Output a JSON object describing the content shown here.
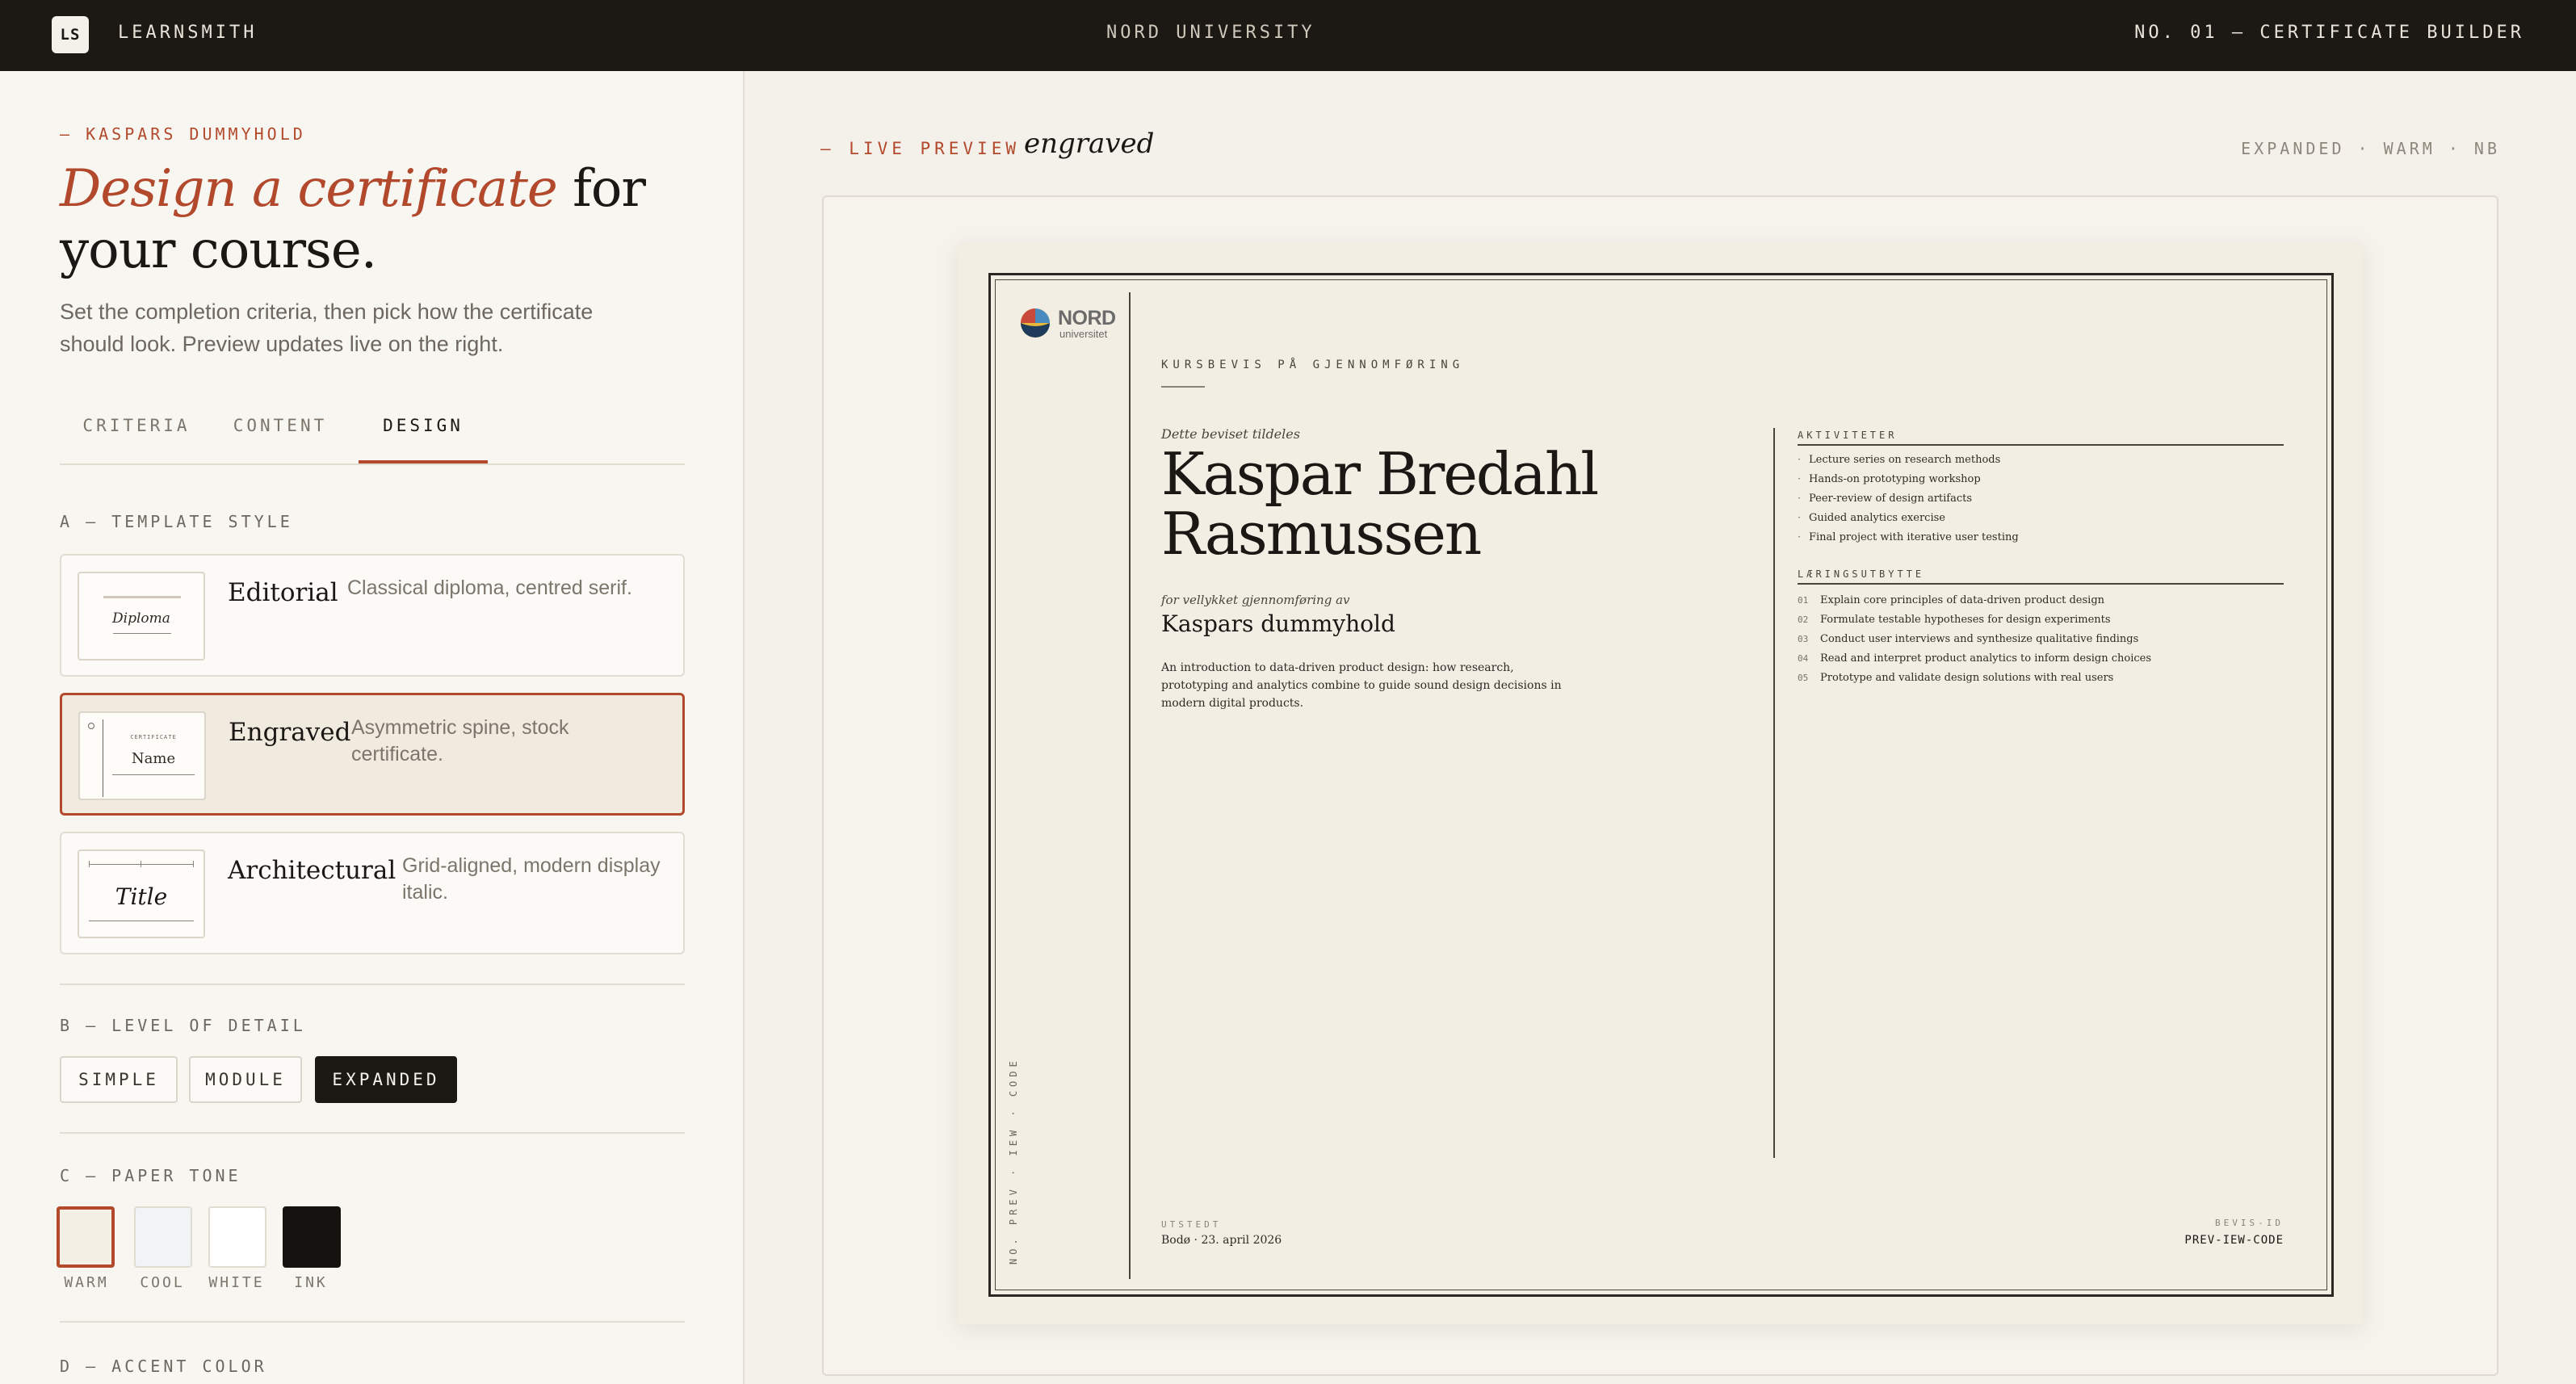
{
  "topbar": {
    "logo": "LS",
    "brand": "LEARNSMITH",
    "center": "NORD UNIVERSITY",
    "builder": "NO. 01 — CERTIFICATE BUILDER"
  },
  "sidebar": {
    "eyebrow": "— KASPARS DUMMYHOLD",
    "headline_em": "Design a certificate",
    "headline_rest": " for your course.",
    "subtitle": "Set the completion criteria, then pick how the certificate should look. Preview updates live on the right.",
    "tabs": [
      {
        "label": "CRITERIA",
        "active": false
      },
      {
        "label": "CONTENT",
        "active": false
      },
      {
        "label": "DESIGN",
        "active": true
      }
    ],
    "template_section": "A — TEMPLATE STYLE",
    "templates": [
      {
        "name": "Editorial",
        "desc": "Classical diploma, centred serif.",
        "thumb_text": "Diploma",
        "selected": false
      },
      {
        "name": "Engraved",
        "desc": "Asymmetric spine, stock certificate.",
        "thumb_small": "CERTIFICATE",
        "thumb_text": "Name",
        "selected": true
      },
      {
        "name": "Architectural",
        "desc": "Grid-aligned, modern display italic.",
        "thumb_text": "Title",
        "selected": false
      }
    ],
    "detail_section": "B — LEVEL OF DETAIL",
    "detail_options": [
      {
        "label": "SIMPLE",
        "active": false
      },
      {
        "label": "MODULE",
        "active": false
      },
      {
        "label": "EXPANDED",
        "active": true
      }
    ],
    "tone_section": "C — PAPER TONE",
    "tones": [
      {
        "label": "WARM",
        "color": "#f4efe4",
        "selected": true
      },
      {
        "label": "COOL",
        "color": "#f2f3f5",
        "selected": false
      },
      {
        "label": "WHITE",
        "color": "#ffffff",
        "selected": false
      },
      {
        "label": "INK",
        "color": "#15120f",
        "selected": false
      }
    ],
    "accent_section": "D — ACCENT COLOR"
  },
  "preview": {
    "eyebrow": "— LIVE PREVIEW",
    "template_name": "engraved",
    "meta": "EXPANDED · WARM · NB"
  },
  "certificate": {
    "institution_logo_text": "NORD",
    "institution_logo_sub": "universitet",
    "spine_text": "NO. PREV · IEW · CODE",
    "eyebrow": "KURSBEVIS PÅ GJENNOMFØRING",
    "awarded_to": "Dette beviset tildeles",
    "recipient": "Kaspar Bredahl Rasmussen",
    "for_completion": "for vellykket gjennomføring av",
    "course": "Kaspars dummyhold",
    "description": "An introduction to data-driven product design: how research, prototyping and analytics combine to guide sound design decisions in modern digital products.",
    "activities_heading": "AKTIVITETER",
    "activities": [
      "Lecture series on research methods",
      "Hands-on prototyping workshop",
      "Peer-review of design artifacts",
      "Guided analytics exercise",
      "Final project with iterative user testing"
    ],
    "outcomes_heading": "LÆRINGSUTBYTTE",
    "outcomes": [
      {
        "num": "01",
        "text": "Explain core principles of data-driven product design"
      },
      {
        "num": "02",
        "text": "Formulate testable hypotheses for design experiments"
      },
      {
        "num": "03",
        "text": "Conduct user interviews and synthesize qualitative findings"
      },
      {
        "num": "04",
        "text": "Read and interpret product analytics to inform design choices"
      },
      {
        "num": "05",
        "text": "Prototype and validate design solutions with real users"
      }
    ],
    "issued_label": "UTSTEDT",
    "issued": "Bodø · 23. april 2026",
    "id_label": "BEVIS-ID",
    "id": "PREV-IEW-CODE"
  },
  "colors": {
    "accent": "#b2492c",
    "topbar": "#1c1814",
    "paper": "#f3eee3"
  }
}
